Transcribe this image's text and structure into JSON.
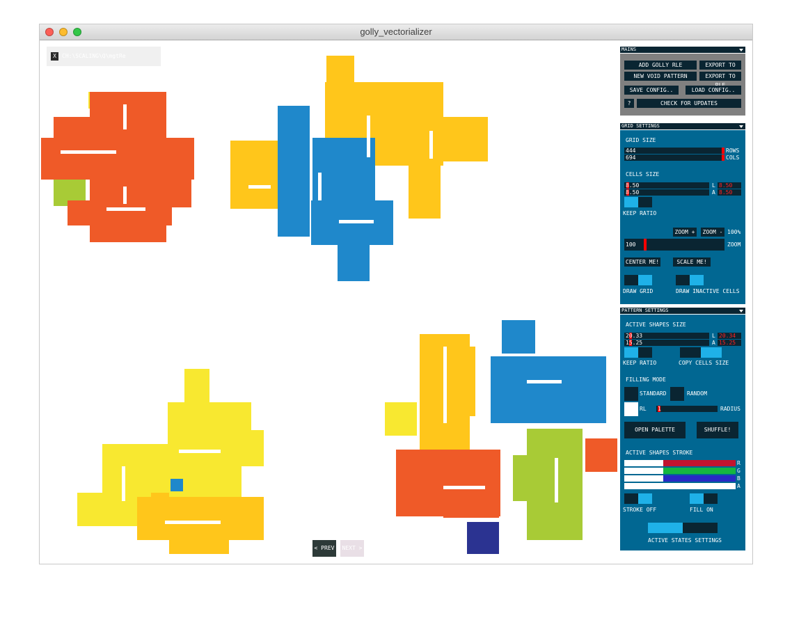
{
  "window": {
    "title": "golly_vectorializer"
  },
  "pattern_name": "CH:\\SCALING\\Q\\mgtRe",
  "close_label": "X",
  "colors": {
    "red": "#ef5a28",
    "blue": "#1f88cb",
    "gold": "#ffc61b",
    "yellow": "#f8e830",
    "lime": "#a8cb36",
    "navy": "#2b3391",
    "panel": "#016792",
    "panel_dark": "#0a2532",
    "toggle_on": "#1fb1e8"
  },
  "mains": {
    "header": "MAINS",
    "add_golly_rle": "ADD GOLLY RLE",
    "export_pdf": "EXPORT TO PDF",
    "new_void_pattern": "NEW VOID PATTERN",
    "export_rle": "EXPORT TO RLE",
    "save_config": "SAVE CONFIG..",
    "load_config": "LOAD CONFIG..",
    "help": "?",
    "check_updates": "CHECK FOR UPDATES"
  },
  "grid": {
    "header": "GRID SETTINGS",
    "grid_size_label": "GRID SIZE",
    "rows_value": "444",
    "rows_label": "ROWS",
    "cols_value": "694",
    "cols_label": "COLS",
    "cells_size_label": "CELLS SIZE",
    "cell_l_value": "8.50",
    "cell_l_label": "L",
    "cell_l_num": "8.50",
    "cell_a_value": "8.50",
    "cell_a_label": "A",
    "cell_a_num": "8.50",
    "keep_ratio": "KEEP RATIO",
    "zoom_plus": "ZOOM +",
    "zoom_minus": "ZOOM -",
    "zoom_100": "100%",
    "zoom_value": "100",
    "zoom_label": "ZOOM",
    "center_me": "CENTER ME!",
    "scale_me": "SCALE ME!",
    "draw_grid": "DRAW GRID",
    "draw_inactive": "DRAW INACTIVE CELLS"
  },
  "pattern": {
    "header": "PATTERN SETTINGS",
    "active_shapes_size": "ACTIVE SHAPES SIZE",
    "l_value": "20.33",
    "l_label": "L",
    "l_num": "20.34",
    "a_value": "15.25",
    "a_label": "A",
    "a_num": "15.25",
    "keep_ratio": "KEEP RATIO",
    "copy_cells_size": "COPY CELLS SIZE",
    "filling_mode": "FILLING MODE",
    "standard": "STANDARD",
    "random": "RANDOM",
    "rl": "RL",
    "radius_value": "1",
    "radius_label": "RADIUS",
    "open_palette": "OPEN PALETTE",
    "shuffle": "SHUFFLE!",
    "active_shapes_stroke": "ACTIVE SHAPES STROKE",
    "r": "R",
    "g": "G",
    "b": "B",
    "a": "A",
    "stroke_r": 0.35,
    "stroke_g": 0.35,
    "stroke_b": 0.35,
    "stroke_a": 1.0,
    "stroke_off": "STROKE OFF",
    "fill_on": "FILL ON",
    "active_states_settings": "ACTIVE STATES SETTINGS"
  },
  "nav": {
    "prev": "< PREV",
    "next": "NEXT >"
  }
}
